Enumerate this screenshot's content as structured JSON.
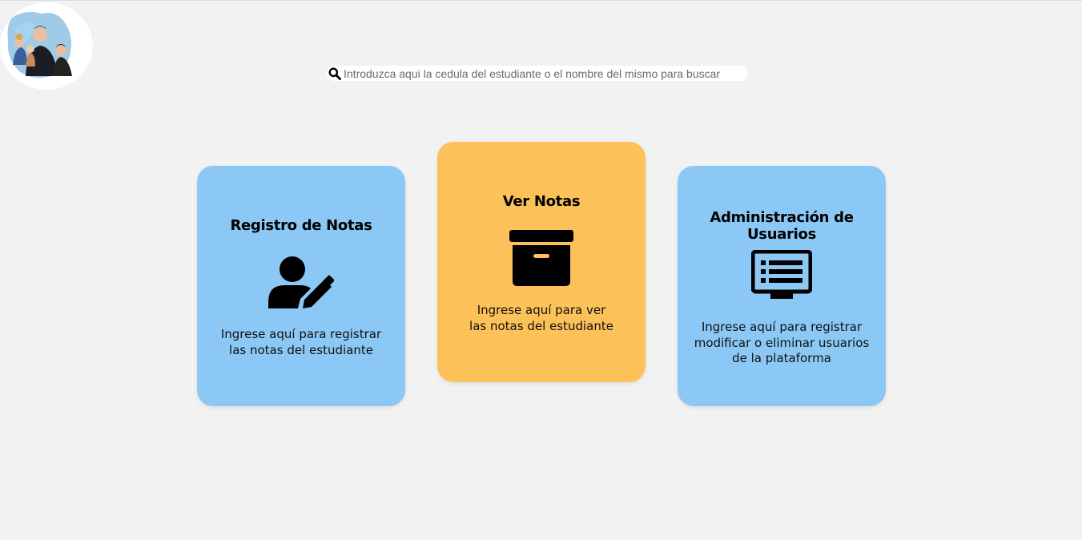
{
  "search": {
    "placeholder": "Introduzca aqui la cedula del estudiante o el nombre del mismo para buscar",
    "icon": "search-icon"
  },
  "colors": {
    "background": "#f2f2f2",
    "card_blue": "#8bc8f5",
    "card_orange": "#fdc159"
  },
  "cards": [
    {
      "title": "Registro de Notas",
      "description": "Ingrese aquí para registrar\nlas notas del estudiante",
      "icon": "user-edit-icon"
    },
    {
      "title": "Ver Notas",
      "description": "Ingrese aquí para ver\nlas notas del estudiante",
      "icon": "archive-box-icon"
    },
    {
      "title": "Administración de Usuarios",
      "description": "Ingrese aquí para registrar\nmodificar o eliminar usuarios\nde la plataforma",
      "icon": "monitor-list-icon"
    }
  ]
}
